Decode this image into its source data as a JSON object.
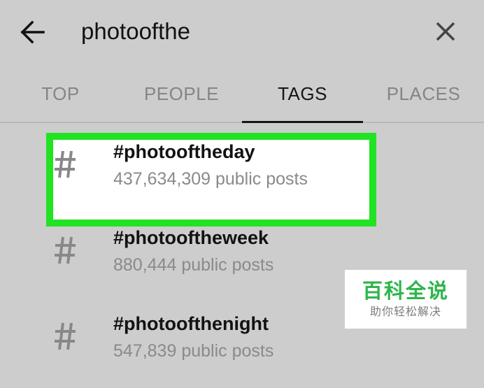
{
  "search": {
    "query": "photoofthe",
    "back_icon": "arrow-left-icon",
    "clear_icon": "close-icon"
  },
  "tabs": [
    {
      "label": "TOP",
      "active": false
    },
    {
      "label": "PEOPLE",
      "active": false
    },
    {
      "label": "TAGS",
      "active": true
    },
    {
      "label": "PLACES",
      "active": false
    }
  ],
  "results": [
    {
      "name": "#photooftheday",
      "count": "437,634,309 public posts",
      "icon": "hashtag-icon",
      "highlighted": true
    },
    {
      "name": "#photooftheweek",
      "count": "880,444 public posts",
      "icon": "hashtag-icon",
      "highlighted": false
    },
    {
      "name": "#photoofthenight",
      "count": "547,839 public posts",
      "icon": "hashtag-icon",
      "highlighted": false
    }
  ],
  "watermark": {
    "title": "百科全说",
    "subtitle": "助你轻松解决"
  },
  "colors": {
    "background": "#cdcdcd",
    "highlight_border": "#22e322",
    "highlight_fill": "#ffffff",
    "watermark_green": "#2db54a",
    "active_tab": "#151515",
    "inactive_tab": "#858585"
  }
}
